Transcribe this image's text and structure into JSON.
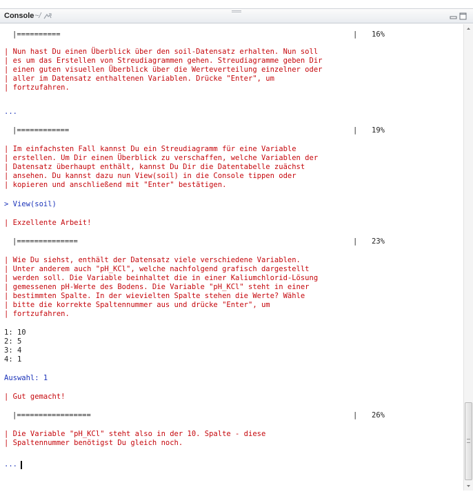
{
  "window": {
    "title": "Console",
    "path": "~/"
  },
  "icons": {
    "navigate": "arrow-icon",
    "minimize": "minimize-icon",
    "maximize": "maximize-icon",
    "scroll_up": "chevron-up-icon",
    "scroll_down": "chevron-down-icon"
  },
  "colors": {
    "message_text": "#c5060b",
    "input_text": "#1b33b9",
    "output_text": "#222222"
  },
  "console": {
    "progress_1": {
      "bar": "|==========",
      "sep": "|",
      "value": "16%"
    },
    "block_1": [
      "| Nun hast Du einen Überblick über den soil-Datensatz erhalten. Nun soll",
      "| es um das Erstellen von Streudiagrammen gehen. Streudiagramme geben Dir",
      "| einen guten visuellen Überblick über die Werteverteilung einzelner oder",
      "| aller im Datensatz enthaltenen Variablen. Drücke \"Enter\", um",
      "| fortzufahren."
    ],
    "ellipsis_1": "...",
    "progress_2": {
      "bar": "|============",
      "sep": "|",
      "value": "19%"
    },
    "block_2": [
      "| Im einfachsten Fall kannst Du ein Streudiagramm für eine Variable",
      "| erstellen. Um Dir einen Überblick zu verschaffen, welche Variablen der",
      "| Datensatz überhaupt enthält, kannst Du Dir die Datentabelle zuächst",
      "| ansehen. Du kannst dazu nun View(soil) in die Console tippen oder",
      "| kopieren und anschließend mit \"Enter\" bestätigen."
    ],
    "input_1": "> View(soil)",
    "feedback_1": "| Exzellente Arbeit!",
    "progress_3": {
      "bar": "|==============",
      "sep": "|",
      "value": "23%"
    },
    "block_3": [
      "| Wie Du siehst, enthält der Datensatz viele verschiedene Variablen.",
      "| Unter anderem auch \"pH_KCl\", welche nachfolgend grafisch dargestellt",
      "| werden soll. Die Variable beinhaltet die in einer Kaliumchlorid-Lösung",
      "| gemessenen pH-Werte des Bodens. Die Variable \"pH_KCl\" steht in einer",
      "| bestimmten Spalte. In der wievielten Spalte stehen die Werte? Wähle",
      "| bitte die korrekte Spaltennummer aus und drücke \"Enter\", um",
      "| fortzufahren."
    ],
    "options": [
      "1: 10",
      "2: 5",
      "3: 4",
      "4: 1"
    ],
    "selection": "Auswahl: 1",
    "feedback_2": "| Gut gemacht!",
    "progress_4": {
      "bar": "|=================",
      "sep": "|",
      "value": "26%"
    },
    "block_4": [
      "| Die Variable \"pH_KCl\" steht also in der 10. Spalte - diese",
      "| Spaltennummer benötigst Du gleich noch."
    ],
    "prompt": "..."
  }
}
